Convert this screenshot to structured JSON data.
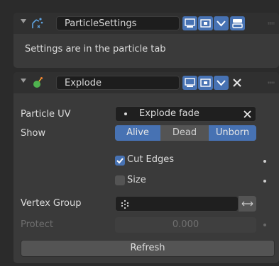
{
  "panel1": {
    "name": "ParticleSettings",
    "info": "Settings are in the particle tab"
  },
  "panel2": {
    "name": "Explode",
    "particle_uv": {
      "label": "Particle UV",
      "value": "Explode fade"
    },
    "show": {
      "label": "Show",
      "options": [
        "Alive",
        "Dead",
        "Unborn"
      ],
      "active": [
        "Alive",
        "Unborn"
      ]
    },
    "cut_edges": {
      "label": "Cut Edges",
      "checked": true
    },
    "size": {
      "label": "Size",
      "checked": false
    },
    "vertex_group": {
      "label": "Vertex Group",
      "value": ""
    },
    "protect": {
      "label": "Protect",
      "value": "0.000"
    },
    "refresh_label": "Refresh"
  },
  "colors": {
    "accent": "#4772b3",
    "panel": "#3a3a3a",
    "header": "#303030",
    "field": "#1d1d1d"
  }
}
